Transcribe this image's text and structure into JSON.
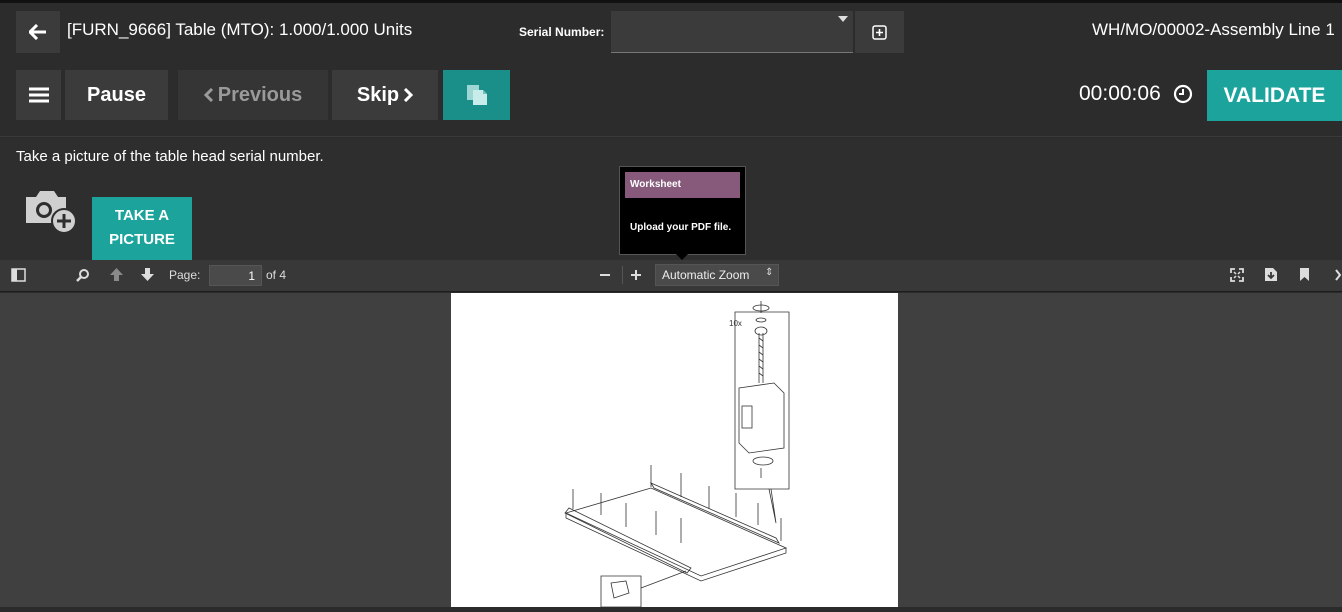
{
  "header": {
    "title": "[FURN_9666] Table (MTO): 1.000/1.000 Units",
    "serial_label": "Serial Number:",
    "serial_value": "",
    "mo_reference": "WH/MO/00002-Assembly Line 1"
  },
  "actions": {
    "pause_label": "Pause",
    "previous_label": "Previous",
    "skip_label": "Skip",
    "timer": "00:00:06",
    "validate_label": "VALIDATE"
  },
  "instruction": {
    "text": "Take a picture of the table head serial number.",
    "take_picture_line1": "TAKE A",
    "take_picture_line2": "PICTURE"
  },
  "tooltip": {
    "title": "Worksheet",
    "body": "Upload your PDF file."
  },
  "pdf_toolbar": {
    "page_label": "Page:",
    "page_current": "1",
    "page_of": "of 4",
    "zoom": "Automatic Zoom"
  },
  "colors": {
    "accent": "#1ca49c",
    "tooltip_header": "#875a7b"
  },
  "icons": [
    "arrow-left-icon",
    "plus-square-icon",
    "hamburger-icon",
    "chevron-left-icon",
    "chevron-right-icon",
    "document-copy-icon",
    "clock-icon",
    "camera-plus-icon",
    "sidebar-toggle-icon",
    "search-icon",
    "arrow-up-icon",
    "arrow-down-icon",
    "minus-icon",
    "plus-icon",
    "fullscreen-icon",
    "download-icon",
    "bookmark-icon"
  ]
}
